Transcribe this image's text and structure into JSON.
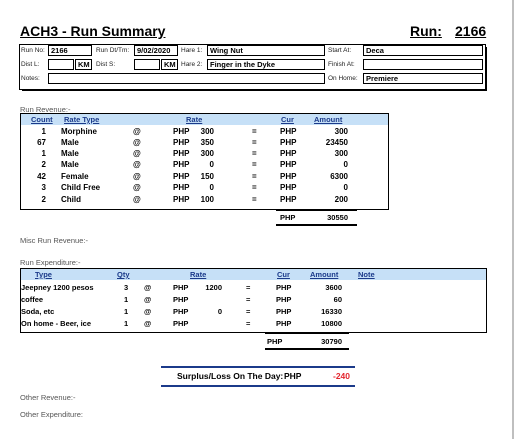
{
  "title": "ACH3 - Run Summary",
  "run_label": "Run:",
  "run_number": "2166",
  "header": {
    "run_no_label": "Run No:",
    "run_no": "2166",
    "run_dt_label": "Run Dt/Tm:",
    "run_dt": "9/02/2020",
    "hare1_label": "Hare 1:",
    "hare1": "Wing Nut",
    "start_label": "Start At:",
    "start": "Deca",
    "dist_l_label": "Dist L:",
    "dist_l": "",
    "km1": "KM",
    "dist_s_label": "Dist S:",
    "dist_s": "",
    "km2": "KM",
    "hare2_label": "Hare 2:",
    "hare2": "Finger in the Dyke",
    "finish_label": "Finish At:",
    "finish": "",
    "notes_label": "Notes:",
    "notes": "",
    "onhome_label": "On Home:",
    "onhome": "Premiere"
  },
  "revenue": {
    "section_label": "Run Revenue:-",
    "headers": {
      "count": "Count",
      "rate_type": "Rate Type",
      "rate": "Rate",
      "cur": "Cur",
      "amount": "Amount"
    },
    "rows": [
      {
        "count": "1",
        "type": "Morphine",
        "at": "@",
        "cur1": "PHP",
        "rate": "300",
        "eq": "=",
        "cur": "PHP",
        "amount": "300"
      },
      {
        "count": "67",
        "type": "Male",
        "at": "@",
        "cur1": "PHP",
        "rate": "350",
        "eq": "=",
        "cur": "PHP",
        "amount": "23450"
      },
      {
        "count": "1",
        "type": "Male",
        "at": "@",
        "cur1": "PHP",
        "rate": "300",
        "eq": "=",
        "cur": "PHP",
        "amount": "300"
      },
      {
        "count": "2",
        "type": "Male",
        "at": "@",
        "cur1": "PHP",
        "rate": "0",
        "eq": "=",
        "cur": "PHP",
        "amount": "0"
      },
      {
        "count": "42",
        "type": "Female",
        "at": "@",
        "cur1": "PHP",
        "rate": "150",
        "eq": "=",
        "cur": "PHP",
        "amount": "6300"
      },
      {
        "count": "3",
        "type": "Child Free",
        "at": "@",
        "cur1": "PHP",
        "rate": "0",
        "eq": "=",
        "cur": "PHP",
        "amount": "0"
      },
      {
        "count": "2",
        "type": "Child",
        "at": "@",
        "cur1": "PHP",
        "rate": "100",
        "eq": "=",
        "cur": "PHP",
        "amount": "200"
      }
    ],
    "total_cur": "PHP",
    "total": "30550"
  },
  "misc_label": "Misc Run Revenue:-",
  "expenditure": {
    "section_label": "Run Expenditure:-",
    "headers": {
      "type": "Type",
      "qty": "Qty",
      "rate": "Rate",
      "cur": "Cur",
      "amount": "Amount",
      "note": "Note"
    },
    "rows": [
      {
        "type": "Jeepney 1200 pesos",
        "qty": "3",
        "at": "@",
        "cur1": "PHP",
        "rate": "1200",
        "eq": "=",
        "cur": "PHP",
        "amount": "3600"
      },
      {
        "type": "coffee",
        "qty": "1",
        "at": "@",
        "cur1": "PHP",
        "rate": "",
        "eq": "=",
        "cur": "PHP",
        "amount": "60"
      },
      {
        "type": "Soda, etc",
        "qty": "1",
        "at": "@",
        "cur1": "PHP",
        "rate": "0",
        "eq": "=",
        "cur": "PHP",
        "amount": "16330"
      },
      {
        "type": "On home - Beer, ice",
        "qty": "1",
        "at": "@",
        "cur1": "PHP",
        "rate": "",
        "eq": "=",
        "cur": "PHP",
        "amount": "10800"
      }
    ],
    "total_cur": "PHP",
    "total": "30790"
  },
  "surplus": {
    "label": "Surplus/Loss On The Day:",
    "cur": "PHP",
    "value": "-240"
  },
  "other_revenue_label": "Other Revenue:-",
  "other_expenditure_label": "Other Expenditure:"
}
